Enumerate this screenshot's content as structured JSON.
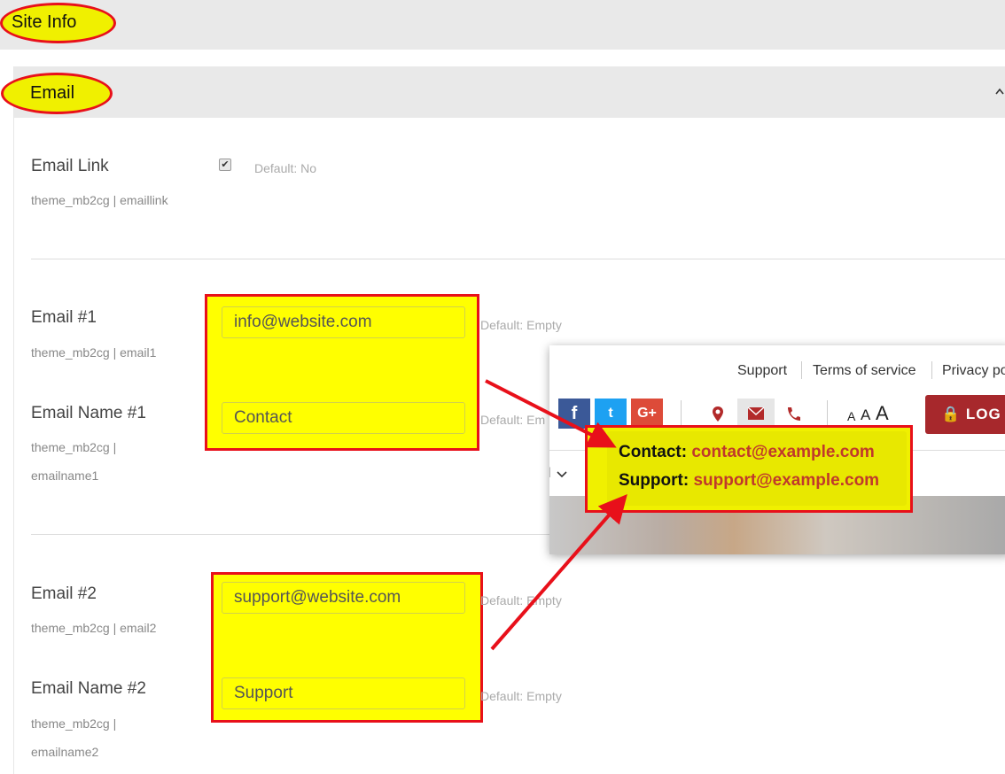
{
  "site_info": {
    "title": "Site Info"
  },
  "email_section": {
    "title": "Email",
    "collapse_icon": "chevron-up-icon"
  },
  "email_link": {
    "label": "Email Link",
    "setting": "theme_mb2cg | emaillink",
    "default": "Default: No",
    "checked": true
  },
  "email1": {
    "label": "Email #1",
    "setting": "theme_mb2cg | email1",
    "value": "info@website.com",
    "default": "Default: Empty"
  },
  "emailname1": {
    "label": "Email Name #1",
    "setting_line1": "theme_mb2cg |",
    "setting_line2": "emailname1",
    "value": "Contact",
    "default": "Default: Em"
  },
  "email2": {
    "label": "Email #2",
    "setting": "theme_mb2cg | email2",
    "value": "support@website.com",
    "default": "Default: Empty"
  },
  "emailname2": {
    "label": "Email Name #2",
    "setting_line1": "theme_mb2cg |",
    "setting_line2": "emailname2",
    "value": "Support",
    "default": "Default: Empty"
  },
  "preview": {
    "links": [
      "Support",
      "Terms of service",
      "Privacy po"
    ],
    "social": [
      {
        "icon": "facebook-icon",
        "glyph": "f",
        "color": "#3b5998"
      },
      {
        "icon": "twitter-icon",
        "glyph": "t",
        "color": "#1da1f2"
      },
      {
        "icon": "google-plus-icon",
        "glyph": "G+",
        "color": "#dd4b39"
      }
    ],
    "font_sizes": [
      "A",
      "A",
      "A"
    ],
    "login_label": "LOG IN",
    "menu_fragment": "l",
    "tooltip": [
      {
        "name": "Contact:",
        "email": "contact@example.com"
      },
      {
        "name": "Support:",
        "email": "support@example.com"
      }
    ]
  }
}
